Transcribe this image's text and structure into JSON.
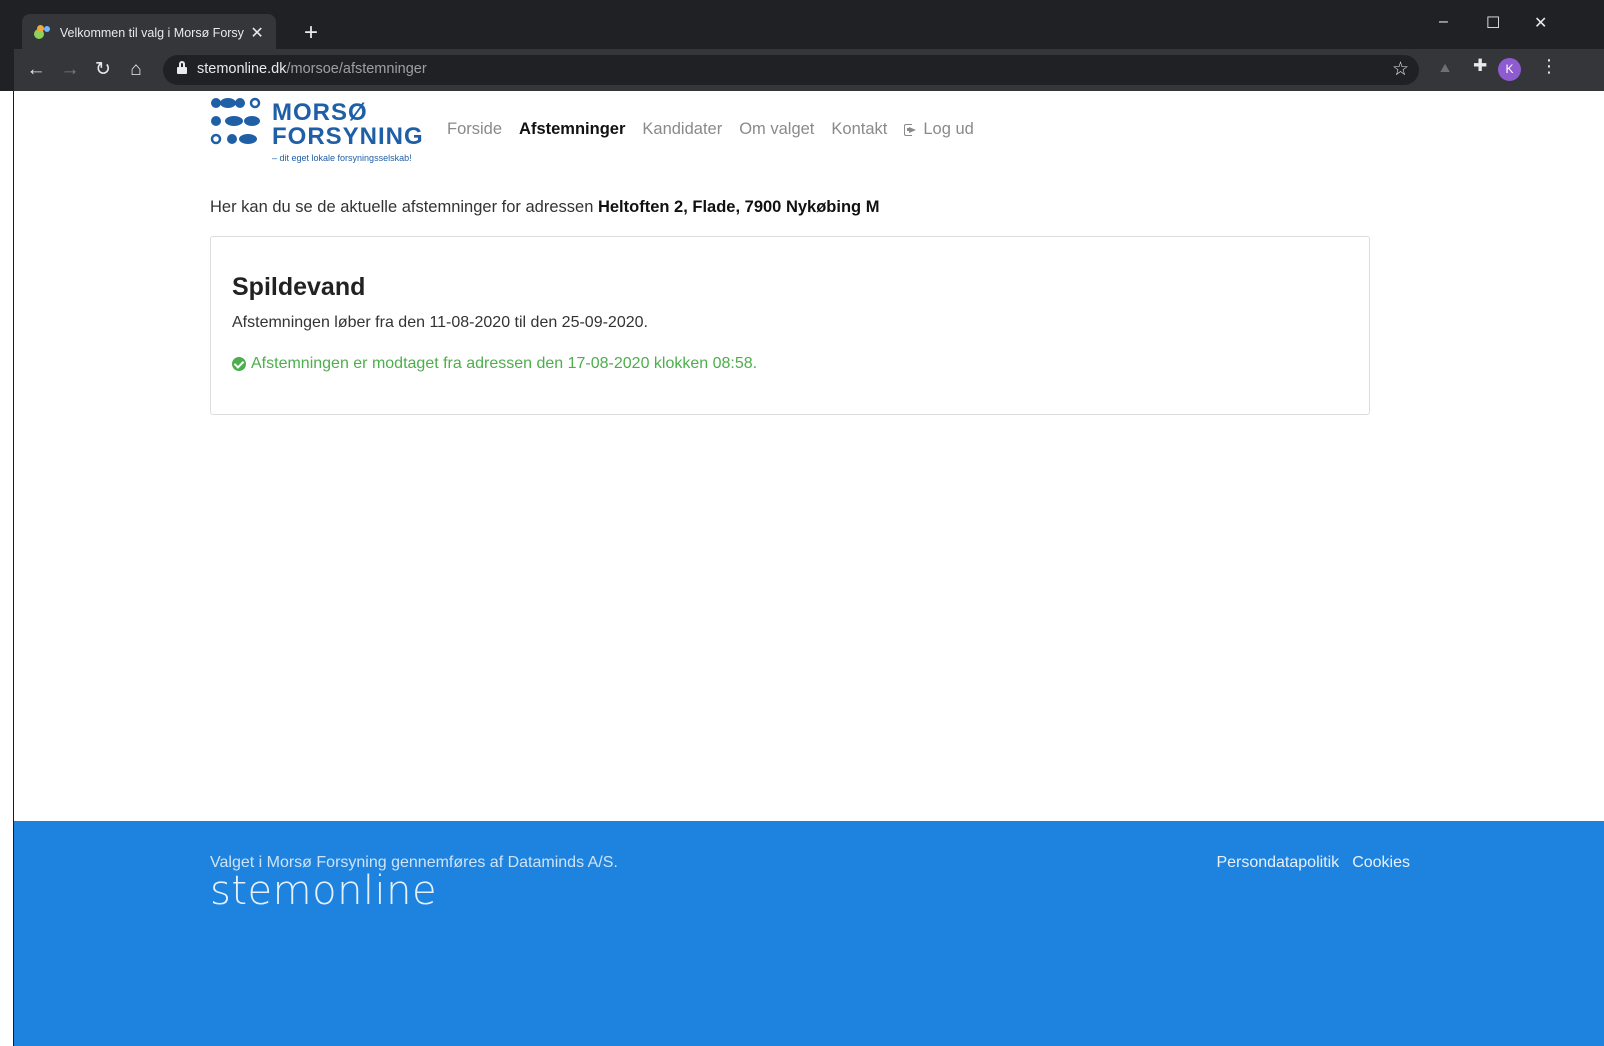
{
  "browser": {
    "tab_title": "Velkommen til valg i Morsø Forsy",
    "tab_close": "✕",
    "new_tab": "+",
    "url_host": "stemonline.dk",
    "url_path": "/morsoe/afstemninger",
    "avatar_initial": "K",
    "window_controls": {
      "minimize": "–",
      "maximize": "☐",
      "close": "✕"
    }
  },
  "logo": {
    "line1": "MORSØ",
    "line2": "FORSYNING",
    "tagline": "– dit eget lokale forsyningsselskab!",
    "brand_color": "#1f5fa6"
  },
  "nav": {
    "items": [
      {
        "label": "Forside",
        "active": false
      },
      {
        "label": "Afstemninger",
        "active": true
      },
      {
        "label": "Kandidater",
        "active": false
      },
      {
        "label": "Om valget",
        "active": false
      },
      {
        "label": "Kontakt",
        "active": false
      }
    ],
    "logout_label": "Log ud"
  },
  "intro": {
    "text": "Her kan du se de aktuelle afstemninger for adressen ",
    "address": "Heltoften 2, Flade, 7900 Nykøbing M"
  },
  "vote_card": {
    "title": "Spildevand",
    "period": "Afstemningen løber fra den 11-08-2020 til den 25-09-2020.",
    "status": "Afstemningen er modtaget fra adressen den 17-08-2020 klokken 08:58.",
    "status_color": "#4cae4c"
  },
  "footer": {
    "text": "Valget i Morsø Forsyning gennemføres af Dataminds A/S.",
    "logo_text": "stemonline",
    "links": [
      "Persondatapolitik",
      "Cookies"
    ],
    "background": "#1e83de"
  }
}
